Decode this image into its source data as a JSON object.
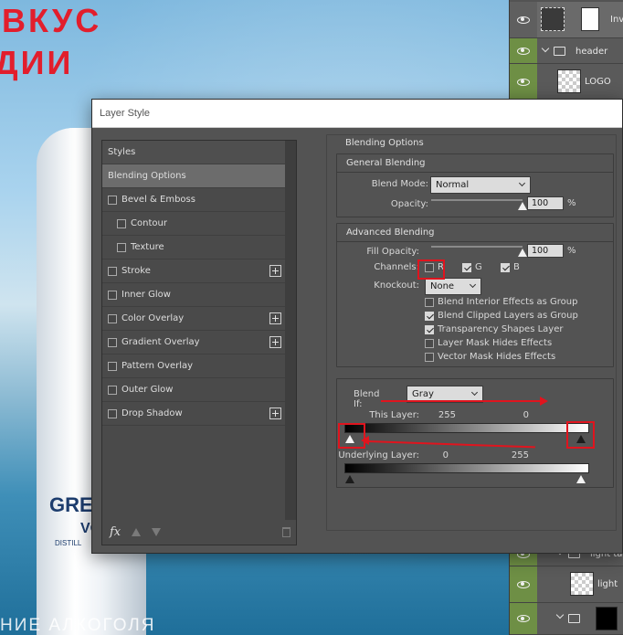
{
  "canvas": {
    "headline_line1": "ВКУС",
    "headline_line2": "ДИИ",
    "bottle_brand": "GREY",
    "bottle_sub": "VO",
    "bottle_small": "DISTILL",
    "footer_text": "НИЕ АЛКОГОЛЯ"
  },
  "layers": {
    "rows": [
      {
        "name": "Inv"
      },
      {
        "name": "header"
      },
      {
        "name": "LOGO"
      },
      {
        "name": "light tab"
      },
      {
        "name": "light"
      }
    ]
  },
  "dialog": {
    "title": "Layer Style",
    "styles_list": [
      {
        "label": "Styles"
      },
      {
        "label": "Blending Options"
      },
      {
        "label": "Bevel & Emboss"
      },
      {
        "label": "Contour"
      },
      {
        "label": "Texture"
      },
      {
        "label": "Stroke"
      },
      {
        "label": "Inner Glow"
      },
      {
        "label": "Color Overlay"
      },
      {
        "label": "Gradient Overlay"
      },
      {
        "label": "Pattern Overlay"
      },
      {
        "label": "Outer Glow"
      },
      {
        "label": "Drop Shadow"
      }
    ],
    "fx_label": "fx",
    "blending_options_title": "Blending Options",
    "general_blending": {
      "title": "General Blending",
      "blend_mode_label": "Blend Mode:",
      "blend_mode_value": "Normal",
      "opacity_label": "Opacity:",
      "opacity_value": "100",
      "opacity_unit": "%",
      "opacity_fraction": 1.0
    },
    "advanced_blending": {
      "title": "Advanced Blending",
      "fill_opacity_label": "Fill Opacity:",
      "fill_opacity_value": "100",
      "fill_opacity_unit": "%",
      "fill_opacity_fraction": 1.0,
      "channels_label": "Channels:",
      "channels": [
        {
          "label": "R",
          "checked": false
        },
        {
          "label": "G",
          "checked": true
        },
        {
          "label": "B",
          "checked": true
        }
      ],
      "knockout_label": "Knockout:",
      "knockout_value": "None",
      "options": [
        {
          "label": "Blend Interior Effects as Group",
          "checked": false
        },
        {
          "label": "Blend Clipped Layers as Group",
          "checked": true
        },
        {
          "label": "Transparency Shapes Layer",
          "checked": true
        },
        {
          "label": "Layer Mask Hides Effects",
          "checked": false
        },
        {
          "label": "Vector Mask Hides Effects",
          "checked": false
        }
      ]
    },
    "blend_if": {
      "label": "Blend If:",
      "value": "Gray",
      "this_layer_label": "This Layer:",
      "this_layer_low": "255",
      "this_layer_high": "0",
      "underlying_label": "Underlying Layer:",
      "underlying_low": "0",
      "underlying_high": "255"
    }
  }
}
